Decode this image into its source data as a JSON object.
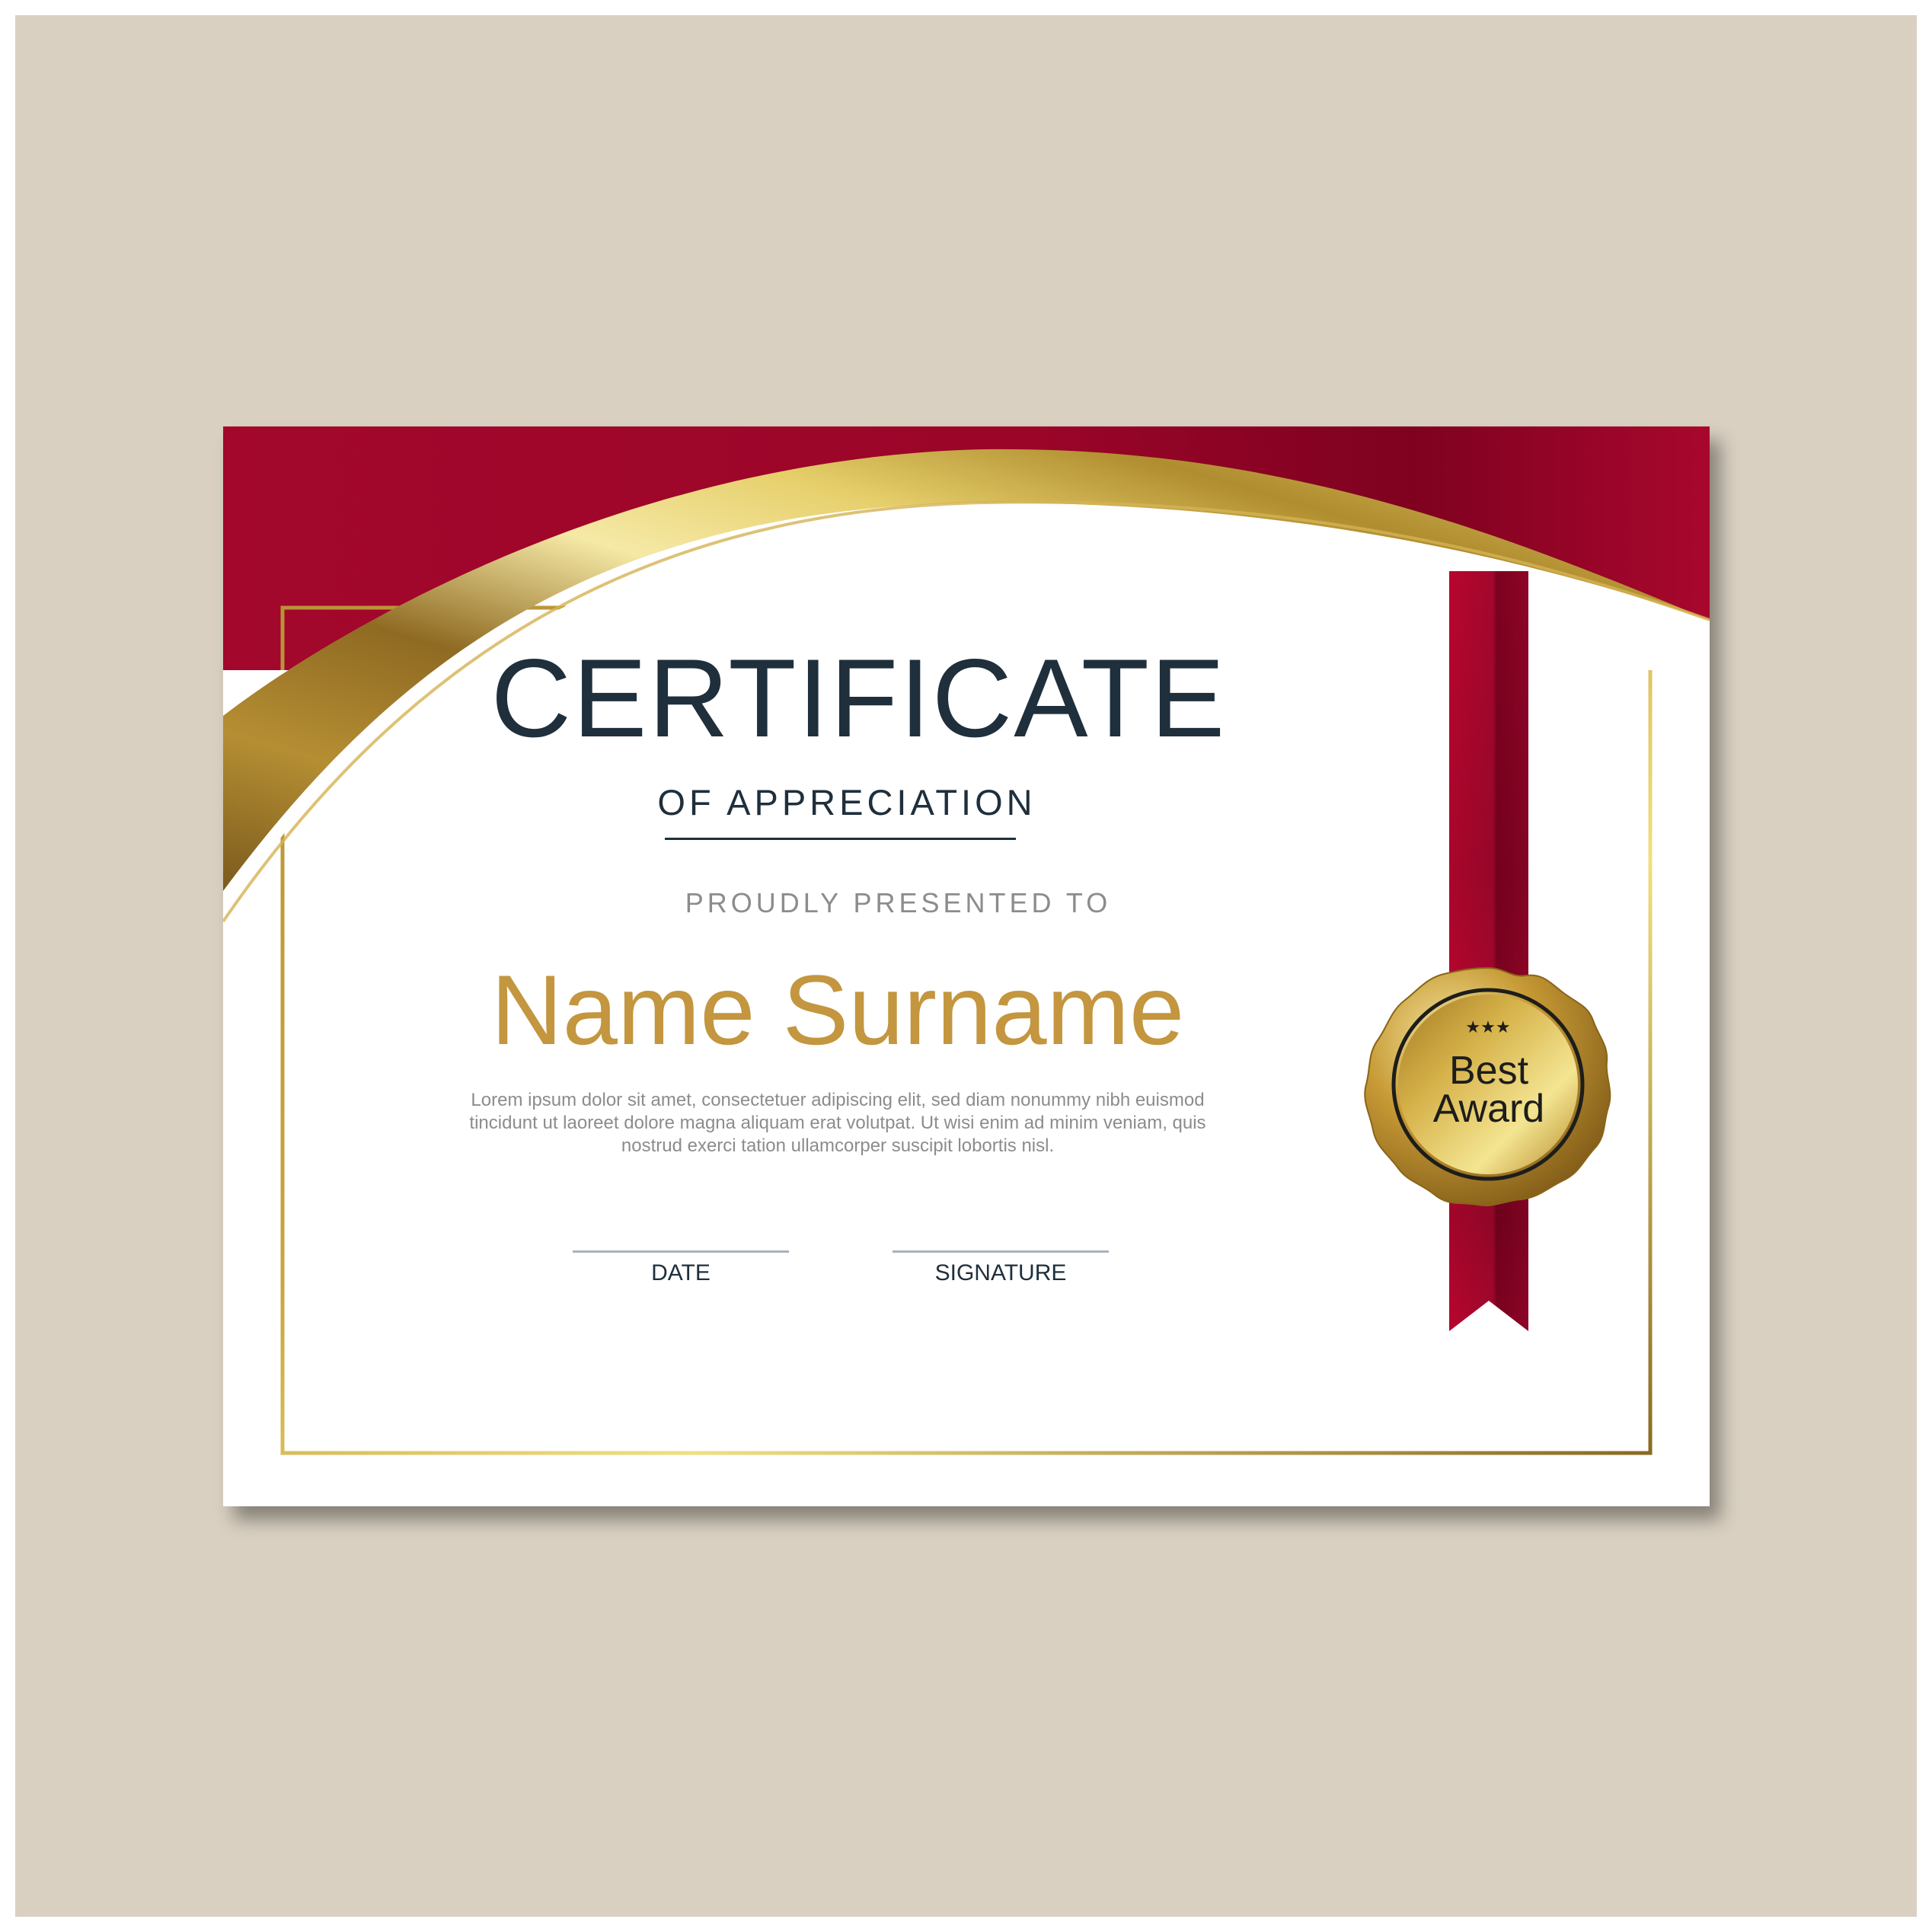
{
  "certificate": {
    "title": "CERTIFICATE",
    "subtitle": "OF APPRECIATION",
    "presented_to": "PROUDLY PRESENTED TO",
    "recipient_name": "Name Surname",
    "body_text": "Lorem ipsum dolor sit amet, consectetuer adipiscing elit, sed diam nonummy nibh euismod tincidunt ut laoreet dolore magna aliquam erat volutpat. Ut wisi enim ad minim veniam, quis nostrud exerci tation ullamcorper suscipit lobortis nisl.",
    "date_label": "DATE",
    "signature_label": "SIGNATURE"
  },
  "seal": {
    "line1": "Best",
    "line2": "Award",
    "stars": "★★★"
  },
  "colors": {
    "backdrop": "#d9d0c1",
    "crimson": "#a3072c",
    "gold": "#c3963f",
    "navy_text": "#1f2f3c",
    "gray_text": "#8c8c8c"
  }
}
